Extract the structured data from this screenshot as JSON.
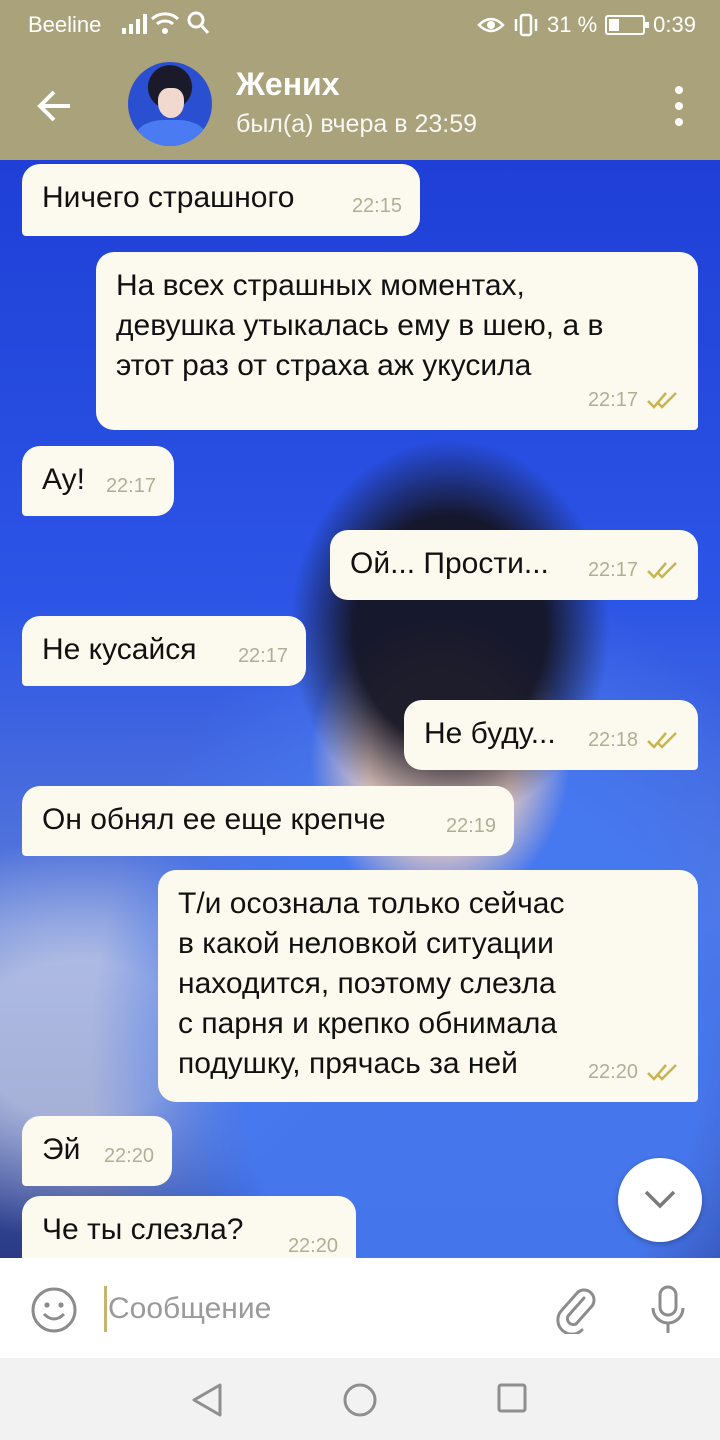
{
  "statusbar": {
    "carrier": "Beeline",
    "battery": "31 %",
    "battery_level": 0.31,
    "time": "0:39"
  },
  "header": {
    "contact_name": "Жених",
    "contact_status": "был(а) вчера в 23:59"
  },
  "messages": [
    {
      "dir": "in",
      "text": "Ничего страшного",
      "time": "22:15"
    },
    {
      "dir": "out",
      "text": "На всех страшных моментах,\nдевушка утыкалась ему в шею, а в\nэтот раз от страха аж укусила",
      "time": "22:17",
      "read": true
    },
    {
      "dir": "in",
      "text": "Ау!",
      "time": "22:17"
    },
    {
      "dir": "out",
      "text": "Ой... Прости...",
      "time": "22:17",
      "read": true
    },
    {
      "dir": "in",
      "text": "Не кусайся",
      "time": "22:17"
    },
    {
      "dir": "out",
      "text": "Не буду...",
      "time": "22:18",
      "read": true
    },
    {
      "dir": "in",
      "text": "Он обнял ее еще крепче",
      "time": "22:19"
    },
    {
      "dir": "out",
      "text": "Т/и осознала только сейчас\nв какой неловкой ситуации\nнаходится, поэтому слезла\nс парня и крепко обнимала\nподушку, прячась за ней",
      "time": "22:20",
      "read": true
    },
    {
      "dir": "in",
      "text": "Эй",
      "time": "22:20"
    },
    {
      "dir": "in",
      "text": "Че ты слезла?",
      "time": "22:20"
    }
  ],
  "input": {
    "placeholder": "Сообщение",
    "value": ""
  },
  "colors": {
    "header": "#A9A27A",
    "bubble": "#FCFAEF",
    "time_text": "#B2AE95",
    "check": "#C9B44F"
  },
  "icons": {
    "back": "arrow-left-icon",
    "menu": "more-vertical-icon",
    "emoji": "smile-icon",
    "attach": "paperclip-icon",
    "mic": "microphone-icon",
    "scroll": "chevron-down-icon"
  }
}
